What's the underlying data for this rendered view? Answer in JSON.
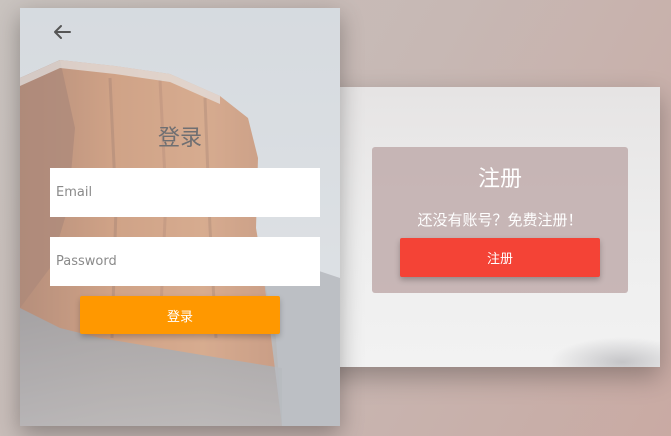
{
  "login": {
    "back_icon": "arrow-left-icon",
    "title": "登录",
    "email_placeholder": "Email",
    "email_value": "",
    "password_placeholder": "Password",
    "password_value": "",
    "button_label": "登录",
    "button_color": "#ff9800"
  },
  "register": {
    "title": "注册",
    "description": "还没有账号？免费注册！",
    "button_label": "注册",
    "button_color": "#f44336"
  }
}
